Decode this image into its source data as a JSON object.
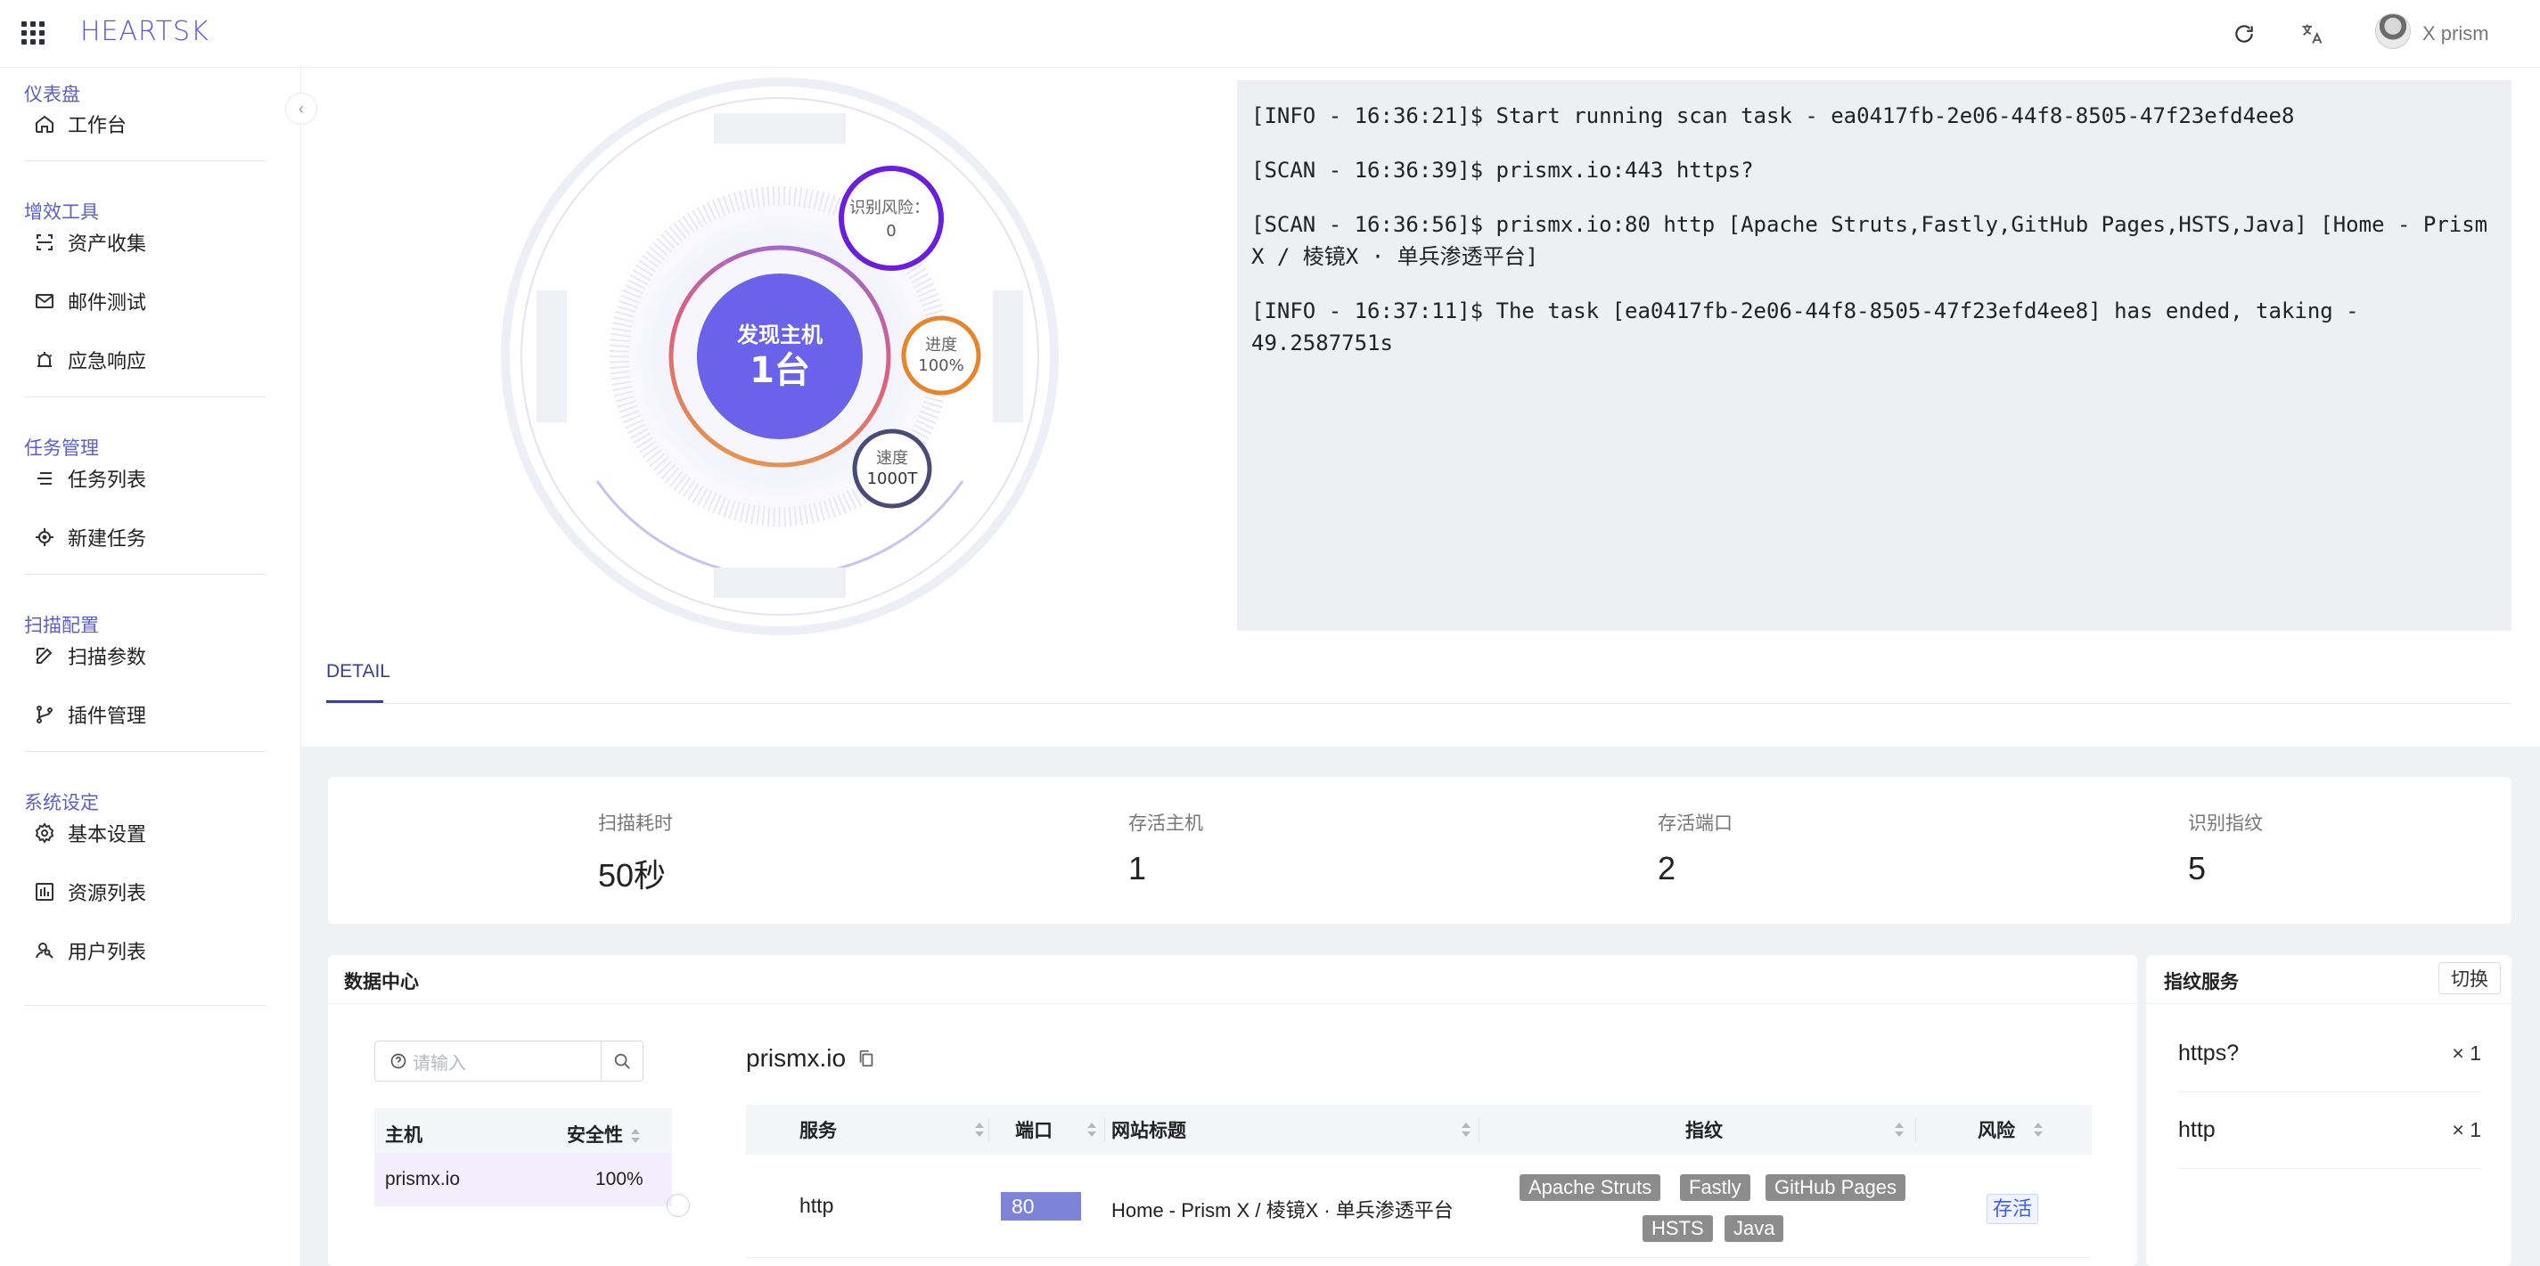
{
  "header": {
    "logo": "HEARTSK",
    "username": "X prism"
  },
  "sidebar": {
    "groups": [
      {
        "title": "仪表盘",
        "items": [
          "工作台"
        ]
      },
      {
        "title": "增效工具",
        "items": [
          "资产收集",
          "邮件测试",
          "应急响应"
        ]
      },
      {
        "title": "任务管理",
        "items": [
          "任务列表",
          "新建任务"
        ]
      },
      {
        "title": "扫描配置",
        "items": [
          "扫描参数",
          "插件管理"
        ]
      },
      {
        "title": "系统设定",
        "items": [
          "基本设置",
          "资源列表",
          "用户列表"
        ]
      }
    ]
  },
  "radar": {
    "center_line1": "发现主机",
    "center_line2": "1台",
    "risk_label": "识别风险：",
    "risk_value": "0",
    "progress_label": "进度",
    "progress_value": "100%",
    "speed_label": "速度",
    "speed_value": "1000T",
    "progress_fraction": 1.0
  },
  "log": {
    "lines": [
      "[INFO - 16:36:21]$ Start running scan task - ea0417fb-2e06-44f8-8505-47f23efd4ee8",
      "[SCAN - 16:36:39]$ prismx.io:443 https?",
      "[SCAN - 16:36:56]$ prismx.io:80 http [Apache Struts,Fastly,GitHub Pages,HSTS,Java] [Home - Prism X / 棱镜X · 单兵渗透平台]",
      "[INFO - 16:37:11]$ The task [ea0417fb-2e06-44f8-8505-47f23efd4ee8] has ended, taking - 49.2587751s"
    ]
  },
  "tabs": {
    "detail": "DETAIL"
  },
  "stats": [
    {
      "label": "扫描耗时",
      "value": "50秒"
    },
    {
      "label": "存活主机",
      "value": "1"
    },
    {
      "label": "存活端口",
      "value": "2"
    },
    {
      "label": "识别指纹",
      "value": "5"
    }
  ],
  "data_center": {
    "title": "数据中心",
    "search_placeholder": "请输入",
    "host_table": {
      "col_host": "主机",
      "col_safety": "安全性",
      "rows": [
        {
          "host": "prismx.io",
          "safety": "100%"
        }
      ]
    },
    "selected_host": "prismx.io",
    "service_table": {
      "col_service": "服务",
      "col_port": "端口",
      "col_title": "网站标题",
      "col_fingerprint": "指纹",
      "col_risk": "风险",
      "rows": [
        {
          "service": "http",
          "port": "80",
          "title": "Home - Prism X / 棱镜X · 单兵渗透平台",
          "fingerprints": [
            "Apache Struts",
            "Fastly",
            "GitHub Pages",
            "HSTS",
            "Java"
          ],
          "risk": "存活"
        }
      ]
    }
  },
  "fingerprint_services": {
    "title": "指纹服务",
    "switch_label": "切换",
    "items": [
      {
        "name": "https?",
        "count": "× 1"
      },
      {
        "name": "http",
        "count": "× 1"
      }
    ]
  },
  "colors": {
    "accent": "#5a55d6",
    "center_circle": "#6a62ea",
    "risk_ring": "#6a1fe0",
    "progress_ring": "#e8852a",
    "speed_ring": "#4a4a78",
    "port_badge": "#7d83d6"
  }
}
